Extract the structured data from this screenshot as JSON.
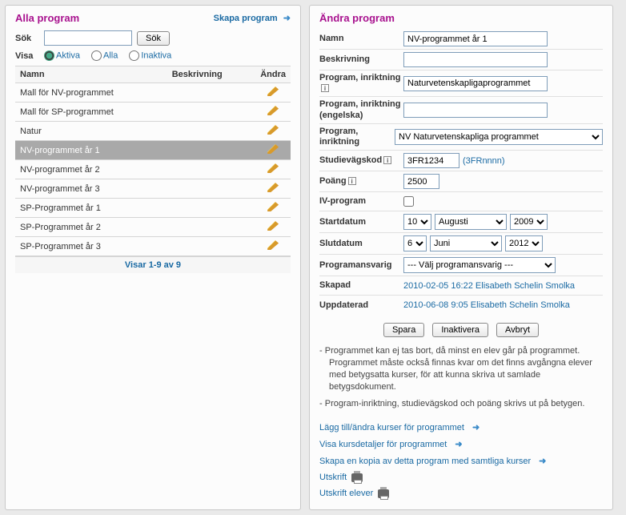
{
  "left": {
    "title": "Alla program",
    "create_link": "Skapa program",
    "search_label": "Sök",
    "search_btn": "Sök",
    "show_label": "Visa",
    "filters": {
      "active": "Aktiva",
      "all": "Alla",
      "inactive": "Inaktiva"
    },
    "cols": {
      "name": "Namn",
      "desc": "Beskrivning",
      "edit": "Ändra"
    },
    "rows": [
      {
        "name": "Mall för NV-programmet",
        "desc": "",
        "selected": false
      },
      {
        "name": "Mall för SP-programmet",
        "desc": "",
        "selected": false
      },
      {
        "name": "Natur",
        "desc": "",
        "selected": false
      },
      {
        "name": "NV-programmet år 1",
        "desc": "",
        "selected": true
      },
      {
        "name": "NV-programmet år 2",
        "desc": "",
        "selected": false
      },
      {
        "name": "NV-programmet år 3",
        "desc": "",
        "selected": false
      },
      {
        "name": "SP-Programmet år 1",
        "desc": "",
        "selected": false
      },
      {
        "name": "SP-Programmet år 2",
        "desc": "",
        "selected": false
      },
      {
        "name": "SP-Programmet år 3",
        "desc": "",
        "selected": false
      }
    ],
    "pager": "Visar 1-9 av 9"
  },
  "right": {
    "title": "Ändra program",
    "labels": {
      "name": "Namn",
      "desc": "Beskrivning",
      "prog_dir": "Program, inriktning",
      "prog_dir_en": "Program, inriktning (engelska)",
      "prog_dir_sel": "Program, inriktning",
      "study_code": "Studievägskod",
      "points": "Poäng",
      "iv": "IV-program",
      "start": "Startdatum",
      "end": "Slutdatum",
      "responsible": "Programansvarig",
      "created": "Skapad",
      "updated": "Uppdaterad"
    },
    "values": {
      "name": "NV-programmet år 1",
      "desc": "",
      "prog_dir": "Naturvetenskapligaprogrammet",
      "prog_dir_en": "",
      "prog_dir_sel": "NV Naturvetenskapliga programmet",
      "study_code": "3FR1234",
      "study_code_hint": "(3FRnnnn)",
      "points": "2500",
      "iv": false,
      "start_day": "10",
      "start_month": "Augusti",
      "start_year": "2009",
      "end_day": "6",
      "end_month": "Juni",
      "end_year": "2012",
      "responsible": "--- Välj programansvarig ---",
      "created": "2010-02-05 16:22 Elisabeth Schelin Smolka",
      "updated": "2010-06-08 9:05 Elisabeth Schelin Smolka"
    },
    "buttons": {
      "save": "Spara",
      "deactivate": "Inaktivera",
      "cancel": "Avbryt"
    },
    "notes": [
      "Programmet kan ej tas bort, då minst en elev går på programmet. Programmet måste också finnas kvar om det finns avgångna elever med betygsatta kurser, för att kunna skriva ut samlade betygsdokument.",
      "Program-inriktning, studievägskod och poäng skrivs ut på betygen."
    ],
    "actions": {
      "add_courses": "Lägg till/ändra kurser för programmet",
      "view_courses": "Visa kursdetaljer för programmet",
      "copy": "Skapa en kopia av detta program med samtliga kurser",
      "print": "Utskrift",
      "print_students": "Utskrift elever"
    }
  }
}
